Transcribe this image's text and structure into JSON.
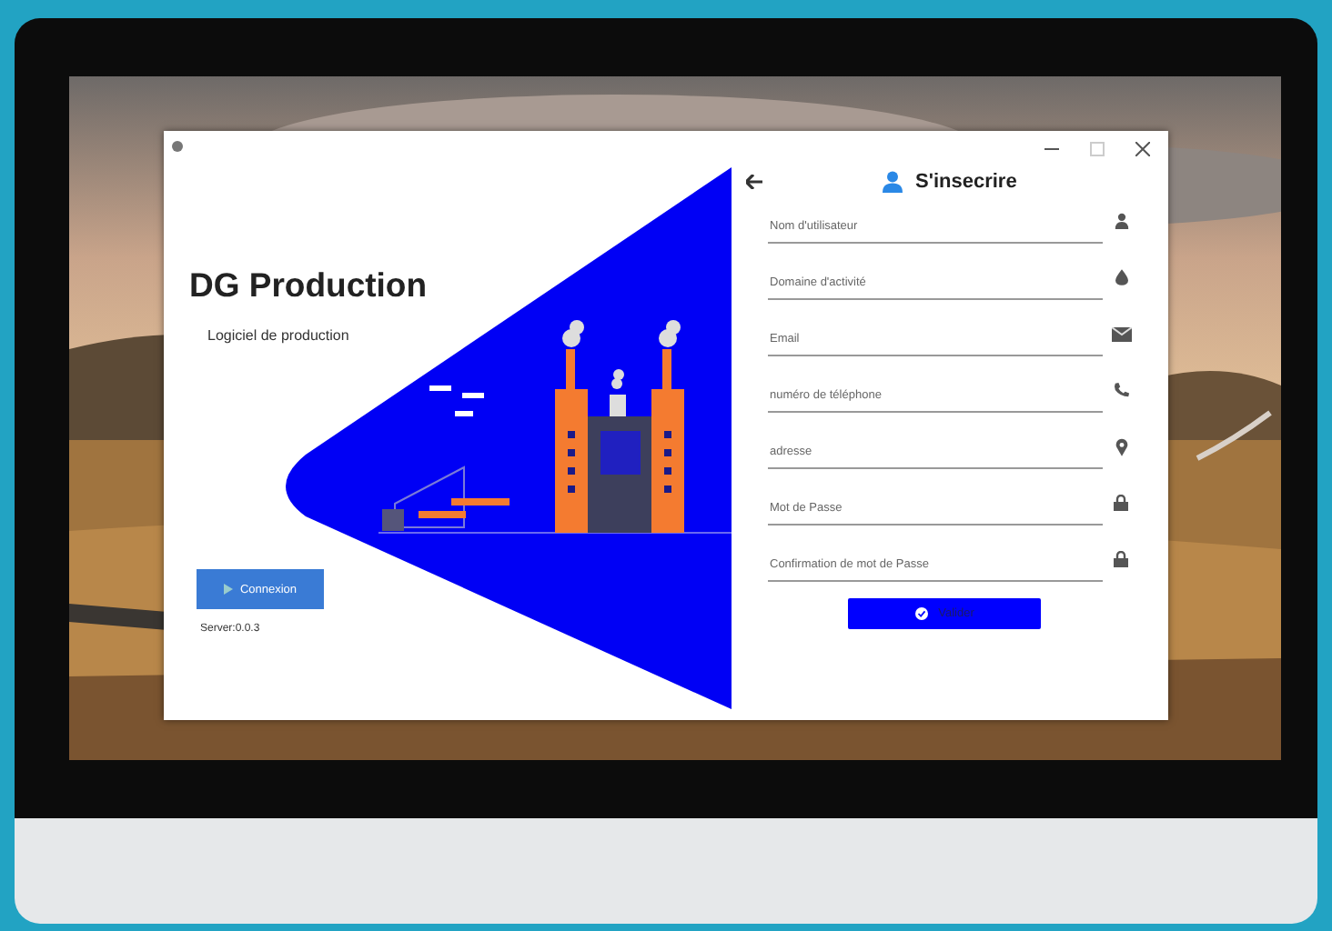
{
  "brand": {
    "title": "DG Production",
    "subtitle": "Logiciel de production"
  },
  "login_button": {
    "label": "Connexion"
  },
  "server_label": "Server:0.0.3",
  "form": {
    "title": "S'insecrire",
    "fields": [
      {
        "placeholder": "Nom d'utilisateur",
        "kind": "user"
      },
      {
        "placeholder": "Domaine d'activité",
        "kind": "drop"
      },
      {
        "placeholder": "Email",
        "kind": "mail"
      },
      {
        "placeholder": "numéro de téléphone",
        "kind": "phone"
      },
      {
        "placeholder": "adresse",
        "kind": "pin"
      },
      {
        "placeholder": "Mot de Passe",
        "kind": "lock"
      },
      {
        "placeholder": "Confirmation de mot de Passe",
        "kind": "lock"
      }
    ],
    "submit": {
      "label": "Valider"
    }
  }
}
